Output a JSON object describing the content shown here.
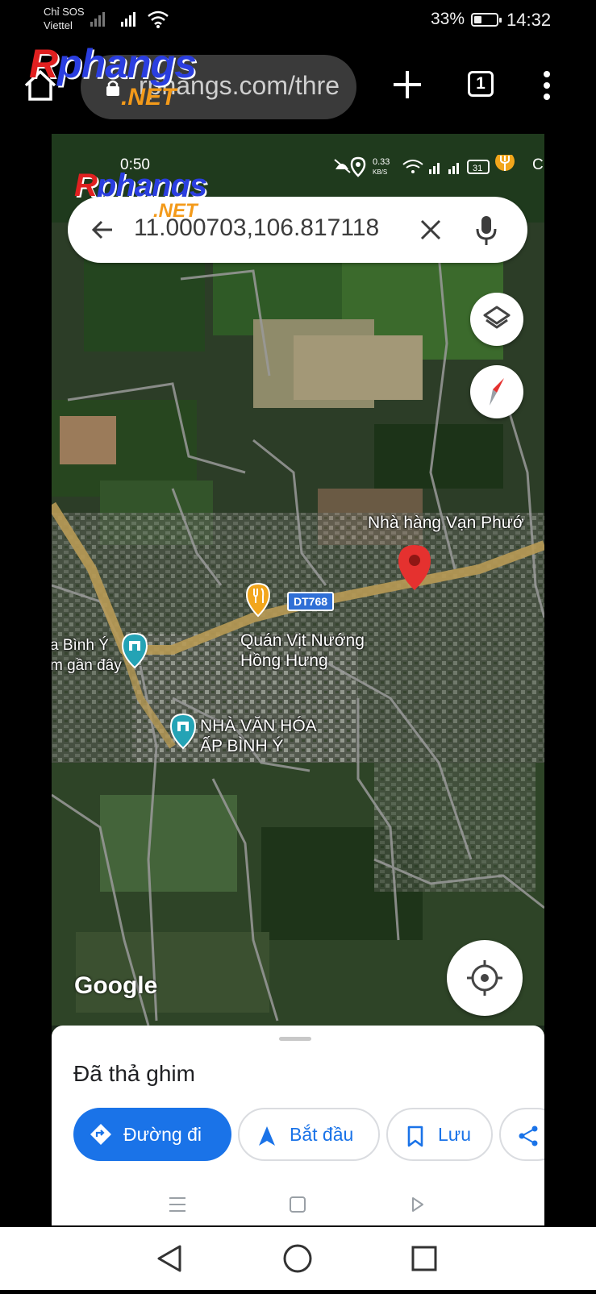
{
  "status_bar": {
    "carrier_line1": "Chỉ SOS",
    "carrier_line2": "Viettel",
    "battery_percent": "33%",
    "battery_level": 0.33,
    "time": "14:32"
  },
  "browser": {
    "url": "rphangs.com/thre",
    "tab_count": "1",
    "icons": [
      "home-icon",
      "lock-icon",
      "plus-icon",
      "tabs-icon",
      "more-vert-icon"
    ]
  },
  "watermark": {
    "brand_part1": "R",
    "brand_part2": "phangs",
    "suffix": ".NET"
  },
  "inner_status": {
    "time": "0:50",
    "speed": "0.33",
    "speed_unit": "KB/S",
    "battery": "31",
    "trailing": "C"
  },
  "search": {
    "query": "11.000703,106.817118"
  },
  "map": {
    "labels": {
      "restaurant": "Nhà hàng Vạn Phướ",
      "road": "DT768",
      "cafe_line1": "Quán Vịt Nướng",
      "cafe_line2": "Hồng Hưng",
      "left_line1": "a Bình Ý",
      "left_line2": "m gần đây",
      "culture_line1": "NHÀ VĂN HÓA",
      "culture_line2": "ẤP BÌNH Ý"
    },
    "attribution": "Google",
    "colors": {
      "pin": "#e5312f",
      "road": "#b89a55",
      "poi_food": "#f2a61c",
      "poi_civic": "#24a3b5"
    }
  },
  "sheet": {
    "title": "Đã thả ghim",
    "directions_label": "Đường đi",
    "start_label": "Bắt đầu",
    "save_label": "Lưu"
  },
  "accent": "#1a73e8"
}
